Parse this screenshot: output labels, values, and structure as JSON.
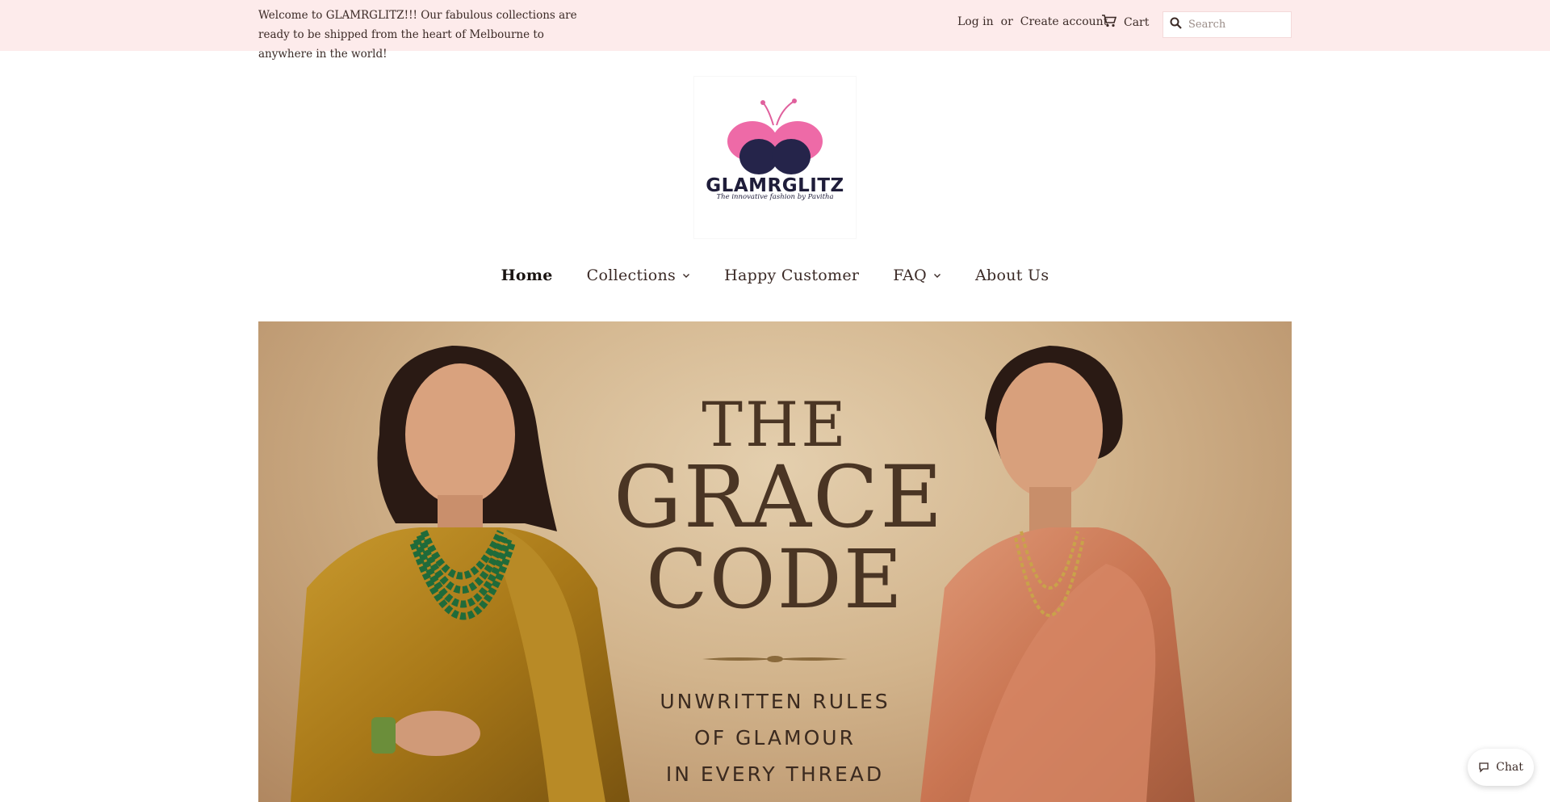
{
  "header": {
    "welcome_text": "Welcome to GLAMRGLITZ!!! Our fabulous collections are ready to be shipped from the heart of Melbourne to anywhere in the world!",
    "login_label": "Log in",
    "or_label": "or",
    "create_account_label": "Create account",
    "cart_label": "Cart",
    "search_placeholder": "Search"
  },
  "logo": {
    "name": "GLAMRGLITZ",
    "tagline": "The innovative fashion by Pavitha"
  },
  "nav": {
    "items": [
      {
        "label": "Home",
        "active": true,
        "dropdown": false
      },
      {
        "label": "Collections",
        "active": false,
        "dropdown": true
      },
      {
        "label": "Happy Customer",
        "active": false,
        "dropdown": false
      },
      {
        "label": "FAQ",
        "active": false,
        "dropdown": true
      },
      {
        "label": "About Us",
        "active": false,
        "dropdown": false
      }
    ]
  },
  "hero": {
    "line1": "THE",
    "line2": "GRACE",
    "line3": "CODE",
    "sub1": "UNWRITTEN RULES",
    "sub2": "OF GLAMOUR",
    "sub3": "IN EVERY THREAD"
  },
  "chat": {
    "label": "Chat"
  },
  "colors": {
    "topbar_bg": "#fdebeb",
    "logo_pink": "#ee6aa7",
    "logo_navy": "#25244a",
    "hero_bg": "#d2b48c",
    "hero_text": "#4a3524"
  }
}
